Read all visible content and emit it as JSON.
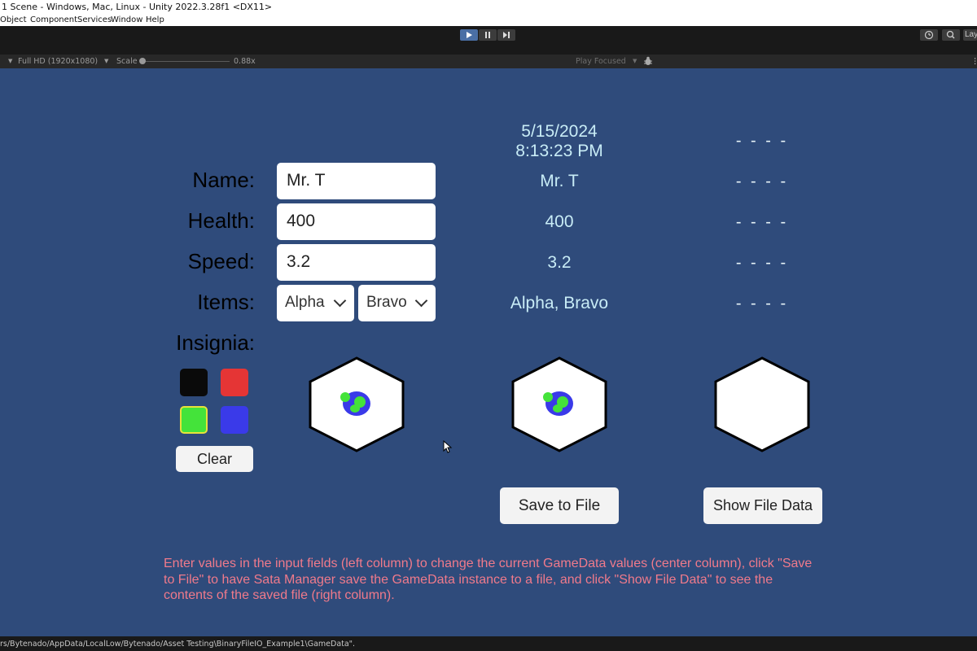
{
  "window": {
    "title": "1 Scene - Windows, Mac, Linux - Unity 2022.3.28f1 <DX11>",
    "menu": [
      "Object",
      "Component",
      "Services",
      "Window",
      "Help"
    ]
  },
  "toolbar": {
    "play_icon": "play-icon",
    "pause_icon": "pause-icon",
    "step_icon": "step-icon",
    "history_icon": "history-icon",
    "search_icon": "search-icon",
    "layout_label": "Lay"
  },
  "gamebar": {
    "resolution": "Full HD (1920x1080)",
    "scale_label": "Scale",
    "scale_value": "0.88x",
    "play_focused": "Play Focused",
    "bug_icon": "bug-icon"
  },
  "form": {
    "name_label": "Name:",
    "health_label": "Health:",
    "speed_label": "Speed:",
    "items_label": "Items:",
    "insignia_label": "Insignia:",
    "name_value": "Mr. T",
    "health_value": "400",
    "speed_value": "3.2",
    "item1": "Alpha",
    "item2": "Bravo",
    "clear_label": "Clear",
    "swatches": {
      "black": "#0a0a0a",
      "red": "#e53535",
      "green": "#44e33a",
      "blue": "#3a3ae9",
      "selected_border": "#e8e23a"
    }
  },
  "current": {
    "date": "5/15/2024",
    "time": "8:13:23 PM",
    "name": "Mr. T",
    "health": "400",
    "speed": "3.2",
    "items": "Alpha, Bravo",
    "save_label": "Save to File"
  },
  "file": {
    "timestamp": "- - - -",
    "name": "- - - -",
    "health": "- - - -",
    "speed": "- - - -",
    "items": "- - - -",
    "show_label": "Show File Data"
  },
  "instructions": "Enter values in the input fields (left column) to change the current GameData values (center column), click \"Save to File\" to have Sata Manager save the GameData instance to a file, and click \"Show File Data\" to see the contents of the saved file (right column).",
  "status": "rs/Bytenado/AppData/LocalLow/Bytenado/Asset Testing\\BinaryFileIO_Example1\\GameData\"."
}
